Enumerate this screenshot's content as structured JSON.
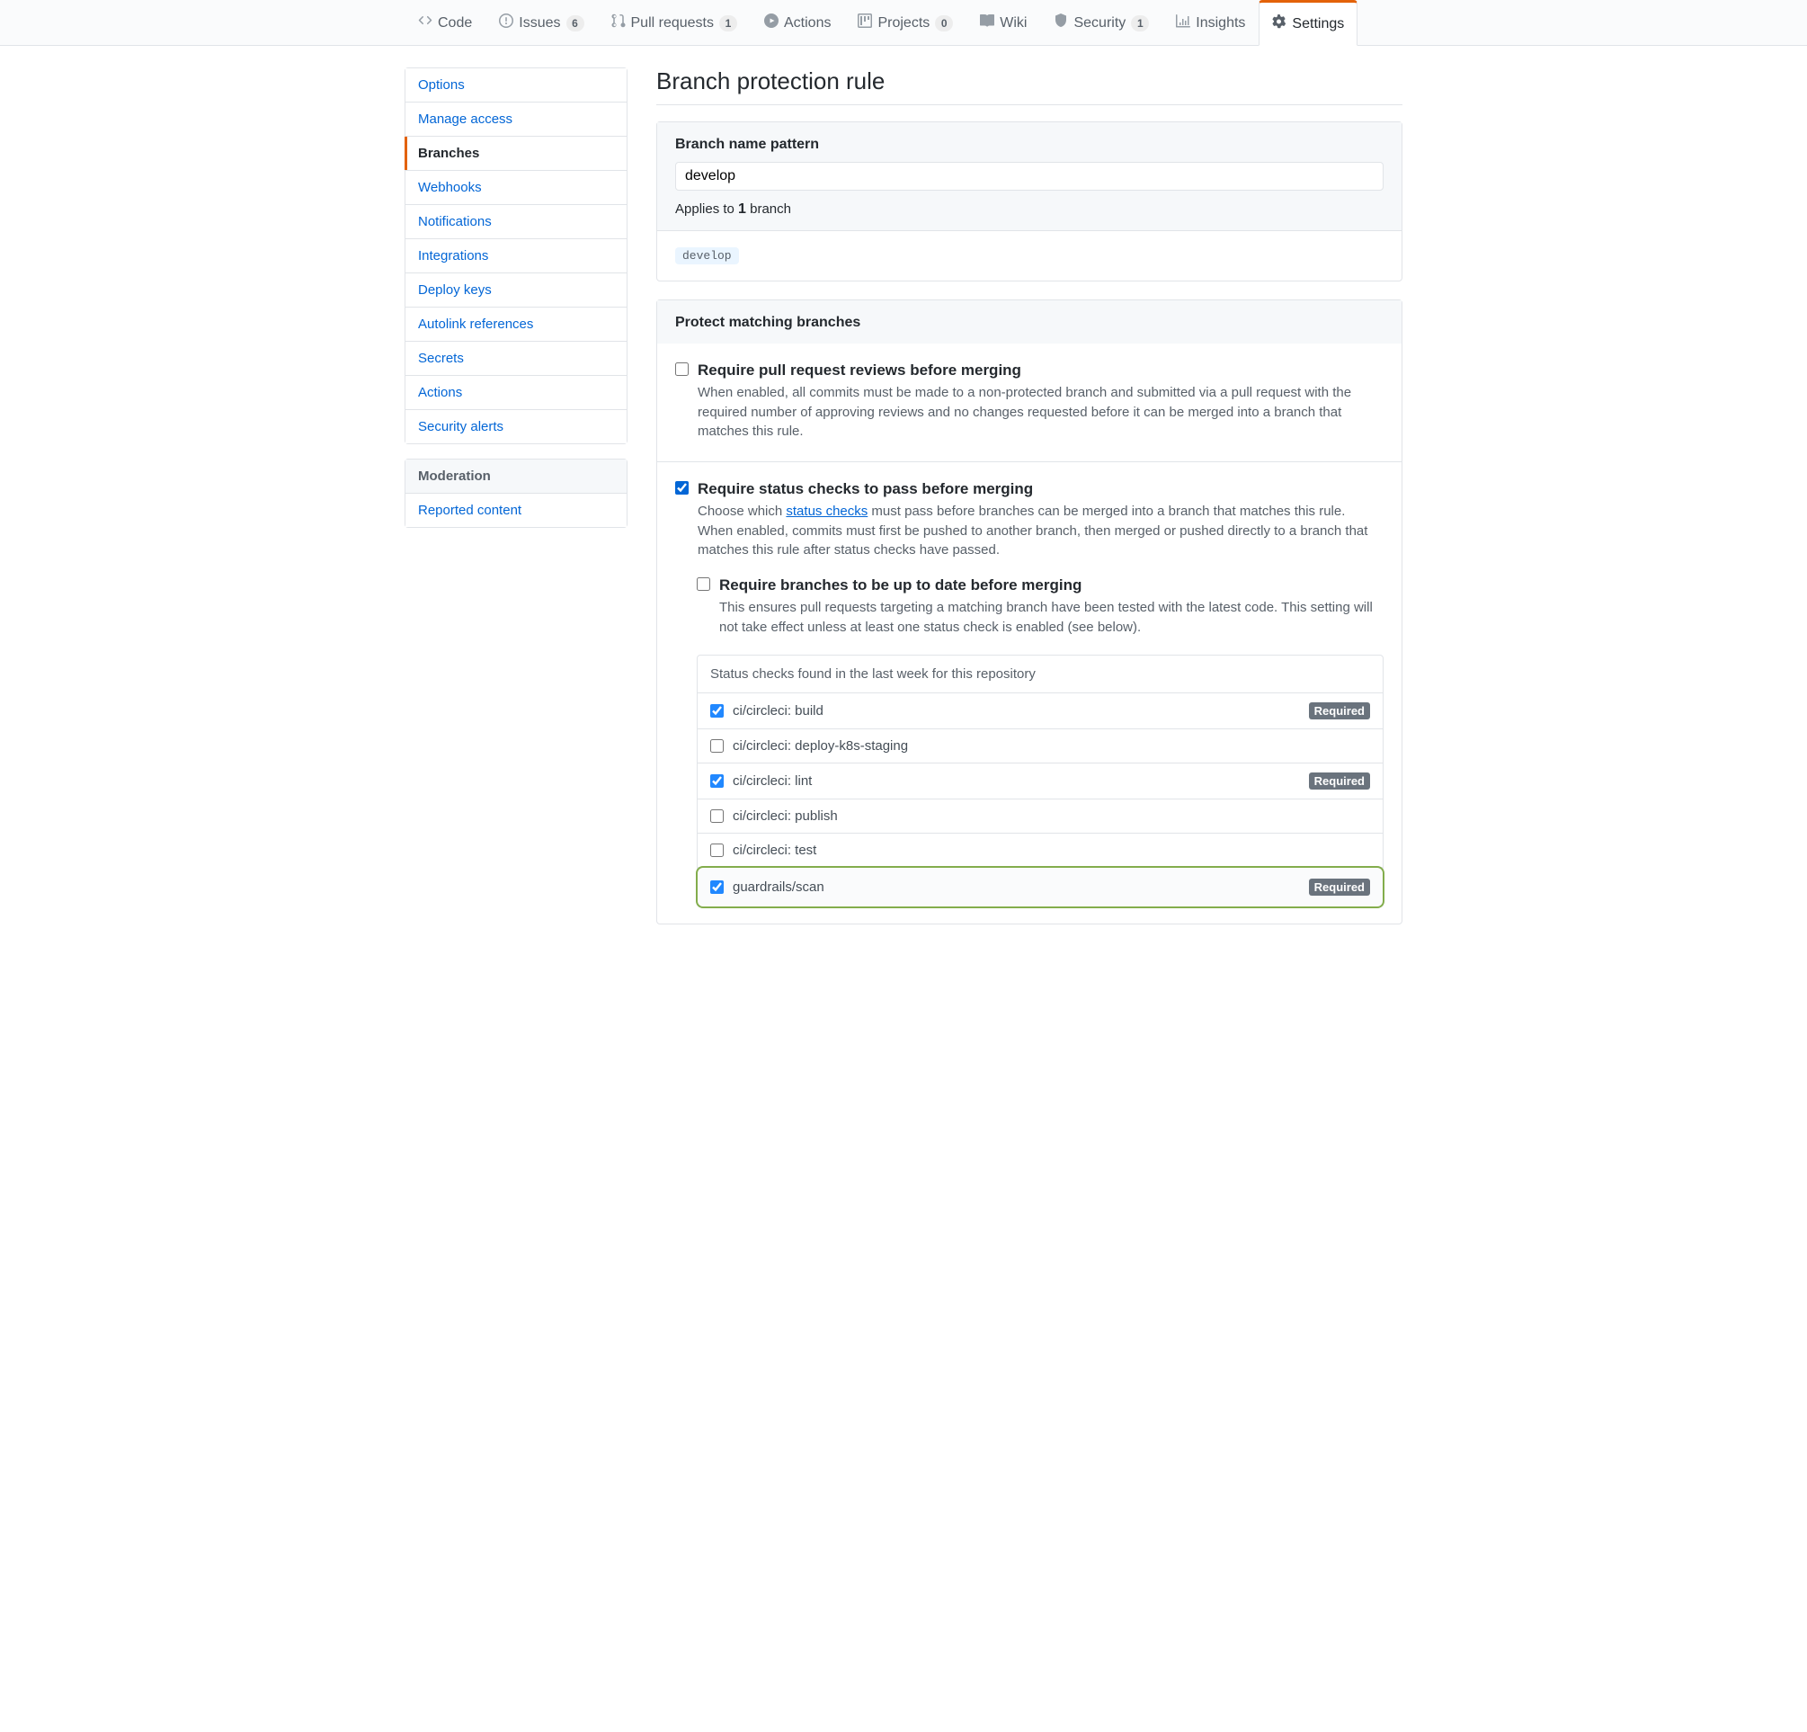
{
  "tabs": [
    {
      "label": "Code",
      "count": null
    },
    {
      "label": "Issues",
      "count": "6"
    },
    {
      "label": "Pull requests",
      "count": "1"
    },
    {
      "label": "Actions",
      "count": null
    },
    {
      "label": "Projects",
      "count": "0"
    },
    {
      "label": "Wiki",
      "count": null
    },
    {
      "label": "Security",
      "count": "1"
    },
    {
      "label": "Insights",
      "count": null
    },
    {
      "label": "Settings",
      "count": null
    }
  ],
  "sidebar": {
    "groups": [
      {
        "heading": null,
        "items": [
          "Options",
          "Manage access",
          "Branches",
          "Webhooks",
          "Notifications",
          "Integrations",
          "Deploy keys",
          "Autolink references",
          "Secrets",
          "Actions",
          "Security alerts"
        ]
      },
      {
        "heading": "Moderation",
        "items": [
          "Reported content"
        ]
      }
    ],
    "selected": "Branches"
  },
  "page_title": "Branch protection rule",
  "pattern": {
    "label": "Branch name pattern",
    "value": "develop",
    "applies_prefix": "Applies to ",
    "applies_count": "1",
    "applies_suffix": " branch",
    "matched_branch": "develop"
  },
  "protect": {
    "heading": "Protect matching branches",
    "rules": [
      {
        "id": "require-pr-reviews",
        "checked": false,
        "title": "Require pull request reviews before merging",
        "note": "When enabled, all commits must be made to a non-protected branch and submitted via a pull request with the required number of approving reviews and no changes requested before it can be merged into a branch that matches this rule."
      },
      {
        "id": "require-status-checks",
        "checked": true,
        "title": "Require status checks to pass before merging",
        "note_pre": "Choose which ",
        "note_link": "status checks",
        "note_post": " must pass before branches can be merged into a branch that matches this rule. When enabled, commits must first be pushed to another branch, then merged or pushed directly to a branch that matches this rule after status checks have passed.",
        "sub": {
          "id": "require-up-to-date",
          "checked": false,
          "title": "Require branches to be up to date before merging",
          "note": "This ensures pull requests targeting a matching branch have been tested with the latest code. This setting will not take effect unless at least one status check is enabled (see below)."
        }
      }
    ]
  },
  "status_checks": {
    "heading": "Status checks found in the last week for this repository",
    "required_label": "Required",
    "items": [
      {
        "name": "ci/circleci: build",
        "checked": true,
        "required": true,
        "highlight": false
      },
      {
        "name": "ci/circleci: deploy-k8s-staging",
        "checked": false,
        "required": false,
        "highlight": false
      },
      {
        "name": "ci/circleci: lint",
        "checked": true,
        "required": true,
        "highlight": false
      },
      {
        "name": "ci/circleci: publish",
        "checked": false,
        "required": false,
        "highlight": false
      },
      {
        "name": "ci/circleci: test",
        "checked": false,
        "required": false,
        "highlight": false
      },
      {
        "name": "guardrails/scan",
        "checked": true,
        "required": true,
        "highlight": true
      }
    ]
  }
}
